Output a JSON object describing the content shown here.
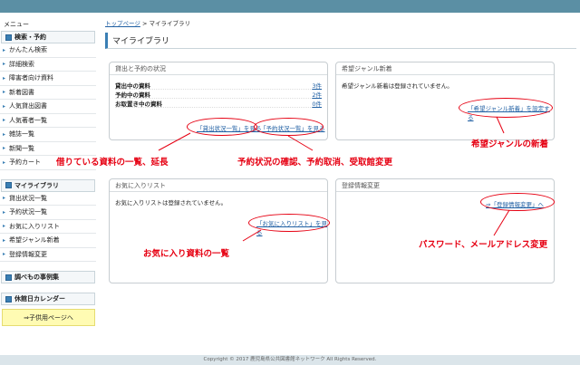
{
  "sidebar": {
    "menu_label": "メニュー",
    "sections": [
      {
        "title": "検索・予約",
        "items": [
          "かんたん検索",
          "詳細検索",
          "障害者向け資料",
          "新着図書",
          "人気貸出図書",
          "人気著者一覧",
          "雑誌一覧",
          "新聞一覧",
          "予約カート"
        ]
      },
      {
        "title": "マイライブラリ",
        "items": [
          "貸出状況一覧",
          "予約状況一覧",
          "お気に入りリスト",
          "希望ジャンル新着",
          "登録情報変更"
        ]
      },
      {
        "title": "調べもの事例集",
        "items": []
      },
      {
        "title": "休館日カレンダー",
        "items": []
      }
    ],
    "kids_link": "⇒子供用ページへ"
  },
  "breadcrumb": {
    "home": "トップページ",
    "sep": ">",
    "current": "マイライブラリ"
  },
  "page_title": "マイライブラリ",
  "panels": {
    "loan": {
      "title": "貸出と予約の状況",
      "rows": [
        {
          "label": "貸出中の資料",
          "value": "3件"
        },
        {
          "label": "予約中の資料",
          "value": "2件"
        },
        {
          "label": "お取置き中の資料",
          "value": "0件"
        }
      ],
      "link_loans": "「貸出状況一覧」を見る",
      "link_reserve": "「予約状況一覧」を見る"
    },
    "genre": {
      "title": "希望ジャンル新着",
      "text": "希望ジャンル新着は登録されていません。",
      "link": "「希望ジャンル新着」を設定する"
    },
    "fav": {
      "title": "お気に入りリスト",
      "text": "お気に入りリストは登録されていません。",
      "link": "「お気に入りリスト」を見る"
    },
    "reg": {
      "title": "登録情報変更",
      "link": "⇒「登録情報変更」へ"
    }
  },
  "annotations": {
    "loans": "借りている資料の一覧、延長",
    "reserve": "予約状況の確認、予約取消、受取館変更",
    "genre": "希望ジャンルの新着",
    "fav": "お気に入り資料の一覧",
    "reg": "パスワード、メールアドレス変更"
  },
  "footer": "Copyright © 2017 鹿児島県公共図書館ネットワーク All Rights Reserved."
}
